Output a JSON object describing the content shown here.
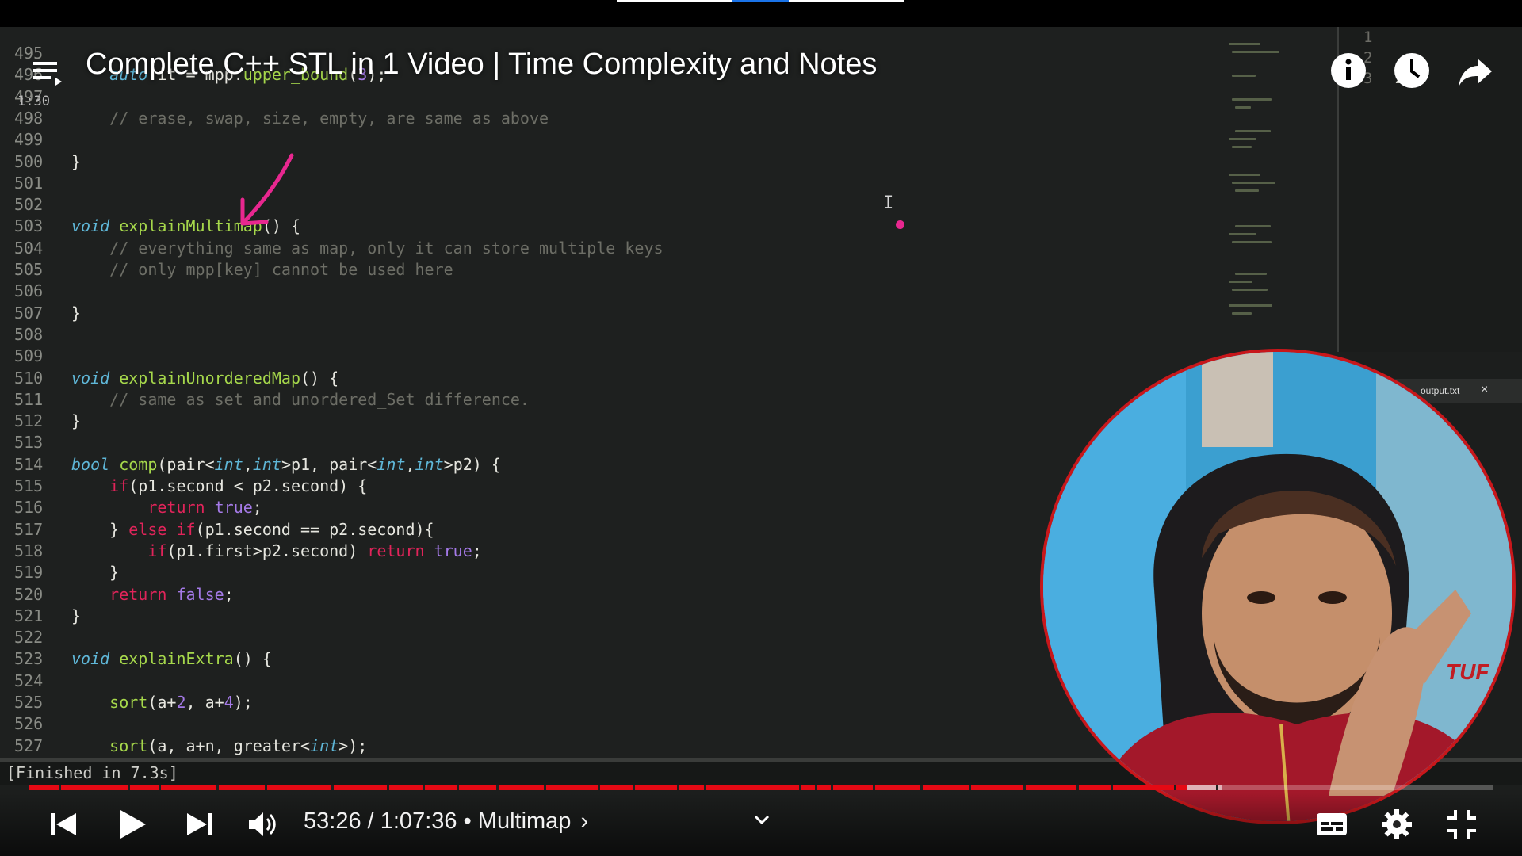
{
  "video": {
    "title": "Complete C++ STL in 1 Video | Time Complexity and Notes"
  },
  "editor": {
    "lines": [
      {
        "n": "495",
        "html": ""
      },
      {
        "n": "496",
        "html": "    <span class=\"kw-type\">auto</span> it = mpp.<span class=\"fn\">upper_bound</span>(<span class=\"num\">3</span>);"
      },
      {
        "n": "497",
        "html": ""
      },
      {
        "n": "498",
        "html": "    <span class=\"cmt\">// erase, swap, size, empty, are same as above</span>"
      },
      {
        "n": "499",
        "html": ""
      },
      {
        "n": "500",
        "html": "}"
      },
      {
        "n": "501",
        "html": ""
      },
      {
        "n": "502",
        "html": ""
      },
      {
        "n": "503",
        "html": "<span class=\"kw-type\">void</span> <span class=\"fn\">explainMultimap</span>() {"
      },
      {
        "n": "504",
        "html": "    <span class=\"cmt\">// everything same as map, only it can store multiple keys</span>"
      },
      {
        "n": "505",
        "html": "    <span class=\"cmt\">// only mpp[key] cannot be used here</span>"
      },
      {
        "n": "506",
        "html": ""
      },
      {
        "n": "507",
        "html": "}"
      },
      {
        "n": "508",
        "html": ""
      },
      {
        "n": "509",
        "html": ""
      },
      {
        "n": "510",
        "html": "<span class=\"kw-type\">void</span> <span class=\"fn\">explainUnorderedMap</span>() {"
      },
      {
        "n": "511",
        "html": "    <span class=\"cmt\">// same as set and unordered_Set difference.</span>"
      },
      {
        "n": "512",
        "html": "}"
      },
      {
        "n": "513",
        "html": ""
      },
      {
        "n": "514",
        "html": "<span class=\"kw-type\">bool</span> <span class=\"fn\">comp</span>(pair&lt;<span class=\"kw-type\">int</span>,<span class=\"kw-type\">int</span>&gt;p1, pair&lt;<span class=\"kw-type\">int</span>,<span class=\"kw-type\">int</span>&gt;p2) {"
      },
      {
        "n": "515",
        "html": "    <span class=\"ctl\">if</span>(p1.second &lt; p2.second) {"
      },
      {
        "n": "516",
        "html": "        <span class=\"ctl\">return</span> <span class=\"bool\">true</span>;"
      },
      {
        "n": "517",
        "html": "    } <span class=\"ctl\">else</span> <span class=\"ctl\">if</span>(p1.second == p2.second){"
      },
      {
        "n": "518",
        "html": "        <span class=\"ctl\">if</span>(p1.first&gt;p2.second) <span class=\"ctl\">return</span> <span class=\"bool\">true</span>;"
      },
      {
        "n": "519",
        "html": "    }"
      },
      {
        "n": "520",
        "html": "    <span class=\"ctl\">return</span> <span class=\"bool\">false</span>;"
      },
      {
        "n": "521",
        "html": "}"
      },
      {
        "n": "522",
        "html": ""
      },
      {
        "n": "523",
        "html": "<span class=\"kw-type\">void</span> <span class=\"fn\">explainExtra</span>() {"
      },
      {
        "n": "524",
        "html": ""
      },
      {
        "n": "525",
        "html": "    <span class=\"fn\">sort</span>(a+<span class=\"num\">2</span>, a+<span class=\"num\">4</span>);"
      },
      {
        "n": "526",
        "html": ""
      },
      {
        "n": "527",
        "html": "    <span class=\"fn\">sort</span>(a, a+n, greater&lt;<span class=\"kw-type\">int</span>&gt;);"
      }
    ],
    "hover_time": "1:30",
    "console_text": "[Finished in 7.3s]",
    "side_panel_lines": [
      {
        "n": "1",
        "v": ""
      },
      {
        "n": "2",
        "v": ""
      },
      {
        "n": "3",
        "v": "2 3"
      }
    ],
    "output_tab_label": "output.txt"
  },
  "player": {
    "current_time": "53:26",
    "duration": "1:07:36",
    "time_separator": " / ",
    "chapter_separator": " • ",
    "chapter": "Multimap",
    "chapter_arrow": "›",
    "played_fraction": 0.791,
    "buffered_fraction": 0.815
  },
  "icons": {
    "menu": "playlist-menu-icon",
    "info": "info-icon",
    "watch_later": "clock-icon",
    "share": "share-icon",
    "prev": "skip-previous-icon",
    "play": "play-icon",
    "next": "skip-next-icon",
    "volume": "volume-icon",
    "captions": "captions-icon",
    "settings": "gear-icon",
    "exit_fullscreen": "exit-fullscreen-icon"
  },
  "colors": {
    "progress_played": "#e50914",
    "webcam_border": "#c8171b",
    "annotation_pink": "#e8278f"
  }
}
